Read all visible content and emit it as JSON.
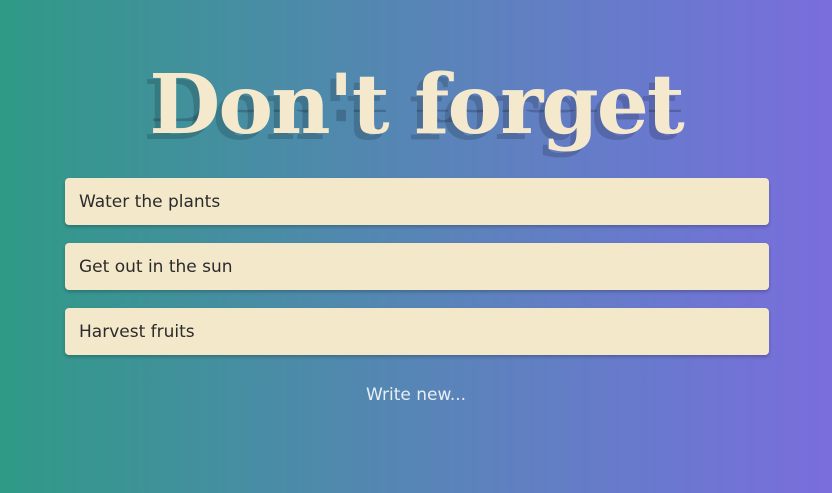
{
  "header": {
    "title": "Don't forget"
  },
  "todos": [
    {
      "text": "Water the plants"
    },
    {
      "text": "Get out in the sun"
    },
    {
      "text": "Harvest fruits"
    }
  ],
  "actions": {
    "write_new_label": "Write new..."
  },
  "colors": {
    "background_start": "#2f9a86",
    "background_end": "#7a6ddc",
    "card": "#f4e8ca",
    "title": "#f4e9cd"
  }
}
